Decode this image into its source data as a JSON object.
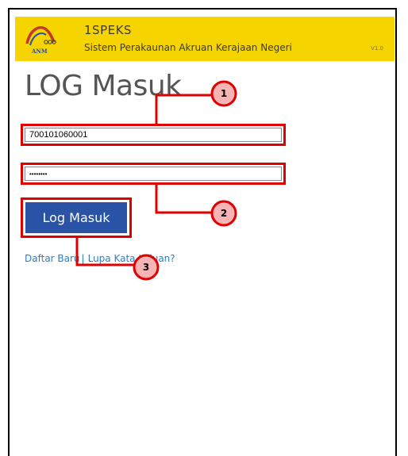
{
  "header": {
    "app_name": "1SPEKS",
    "app_subtitle": "Sistem Perakaunan Akruan Kerajaan Negeri",
    "version": "V1.0",
    "logo_text": "ANM",
    "background_color": "#f5d400"
  },
  "login": {
    "title": "LOG Masuk",
    "username_value": "700101060001",
    "password_value": "••••••••",
    "submit_label": "Log Masuk",
    "button_color": "#2a52a5"
  },
  "links": {
    "register": "Daftar Baru",
    "separator": "|",
    "forgot_password": "Lupa Kata Laluan?"
  },
  "callouts": {
    "highlight_color": "#e00000",
    "badges": [
      "1",
      "2",
      "3"
    ]
  }
}
